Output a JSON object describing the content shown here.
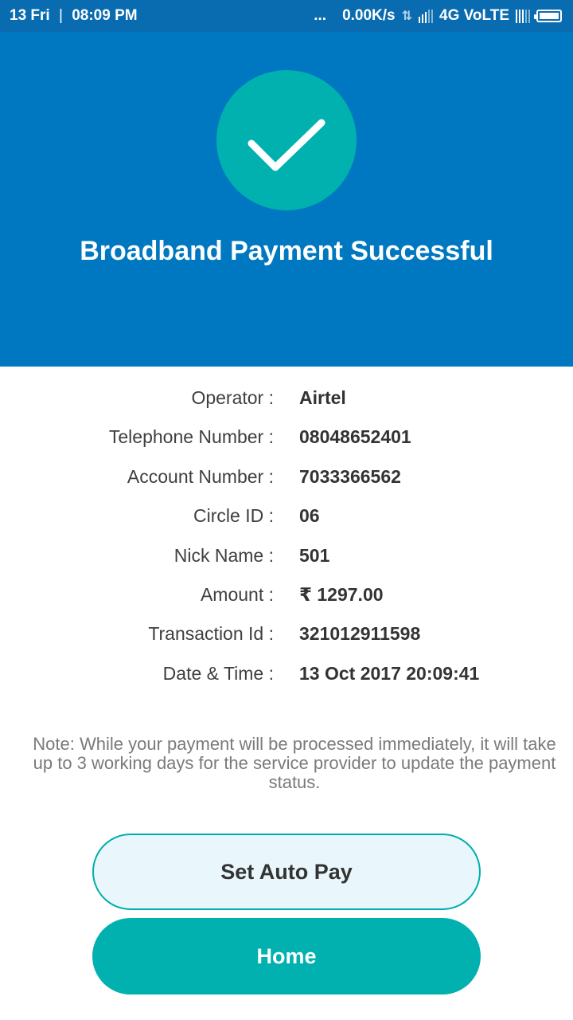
{
  "status_bar": {
    "date": "13 Fri",
    "separator": "|",
    "time": "08:09 PM",
    "dots": "...",
    "speed": "0.00K/s",
    "network": "4G VoLTE",
    "icons": [
      "data-transfer-icon",
      "signal-icon",
      "signal-icon",
      "battery-icon"
    ]
  },
  "hero": {
    "icon": "checkmark-icon",
    "title": "Broadband Payment Successful",
    "circle_color": "#00b1b0",
    "background_color": "#0078c1"
  },
  "details": [
    {
      "label": "Operator :",
      "value": "Airtel"
    },
    {
      "label": "Telephone Number :",
      "value": "08048652401"
    },
    {
      "label": "Account Number :",
      "value": "7033366562"
    },
    {
      "label": "Circle ID :",
      "value": "06"
    },
    {
      "label": "Nick Name :",
      "value": "501"
    },
    {
      "label": "Amount :",
      "value": "₹ 1297.00"
    },
    {
      "label": "Transaction Id :",
      "value": "321012911598"
    },
    {
      "label": "Date & Time :",
      "value": "13 Oct 2017 20:09:41"
    }
  ],
  "note": "Note: While your payment will be processed immediately, it will take up to 3 working days for the service provider to update the payment status.",
  "buttons": {
    "auto_pay": "Set Auto Pay",
    "home": "Home"
  }
}
